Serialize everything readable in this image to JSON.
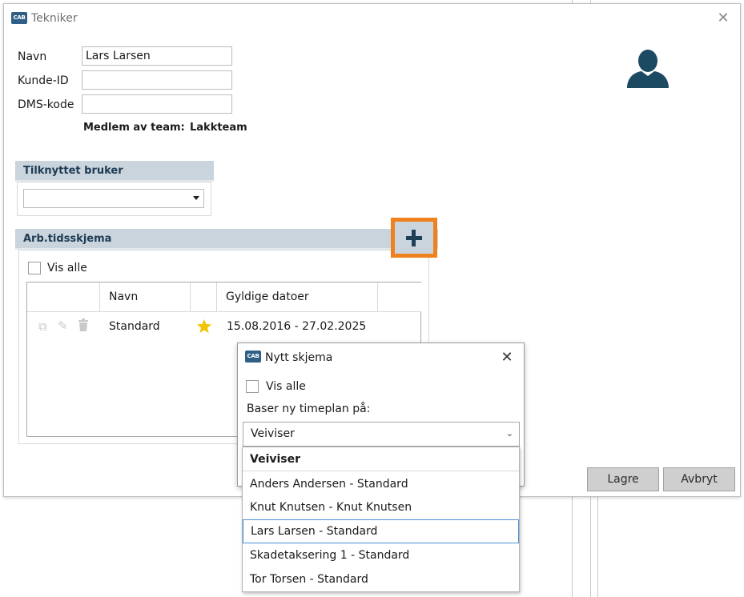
{
  "main_dialog": {
    "title": "Tekniker",
    "app_badge": "CAB",
    "fields": {
      "navn_label": "Navn",
      "navn_value": "Lars Larsen",
      "kunde_id_label": "Kunde-ID",
      "kunde_id_value": "",
      "dms_kode_label": "DMS-kode",
      "dms_kode_value": ""
    },
    "team_label": "Medlem av team:",
    "team_value": "Lakkteam",
    "tilknyttet_header": "Tilknyttet bruker",
    "tilknyttet_value": "",
    "arb_header": "Arb.tidsskjema",
    "vis_alle": "Vis alle",
    "table": {
      "columns": [
        "",
        "Navn",
        "",
        "Gyldige datoer"
      ],
      "rows": [
        {
          "navn": "Standard",
          "star": true,
          "datoer": "15.08.2016 - 27.02.2025"
        }
      ]
    },
    "buttons": {
      "save": "Lagre",
      "cancel": "Avbryt"
    }
  },
  "popup": {
    "title": "Nytt skjema",
    "app_badge": "CAB",
    "vis_alle": "Vis alle",
    "base_label": "Baser ny timeplan på:",
    "selected": "Veiviser",
    "options": [
      "Veiviser",
      "Anders Andersen - Standard",
      "Knut Knutsen - Knut Knutsen",
      "Lars Larsen - Standard",
      "Skadetaksering 1 - Standard",
      "Tor Torsen - Standard"
    ],
    "hovered_option_index": 3
  },
  "icons": {
    "avatar": "person-silhouette-icon",
    "add": "plus-icon",
    "copy": "copy-icon",
    "edit": "pencil-icon",
    "delete": "trash-icon",
    "default_marker": "star-icon"
  },
  "colors": {
    "accent_orange": "#f0811f",
    "section_header": "#c9d4dd",
    "avatar": "#1d4a63",
    "star": "#f2c300"
  }
}
